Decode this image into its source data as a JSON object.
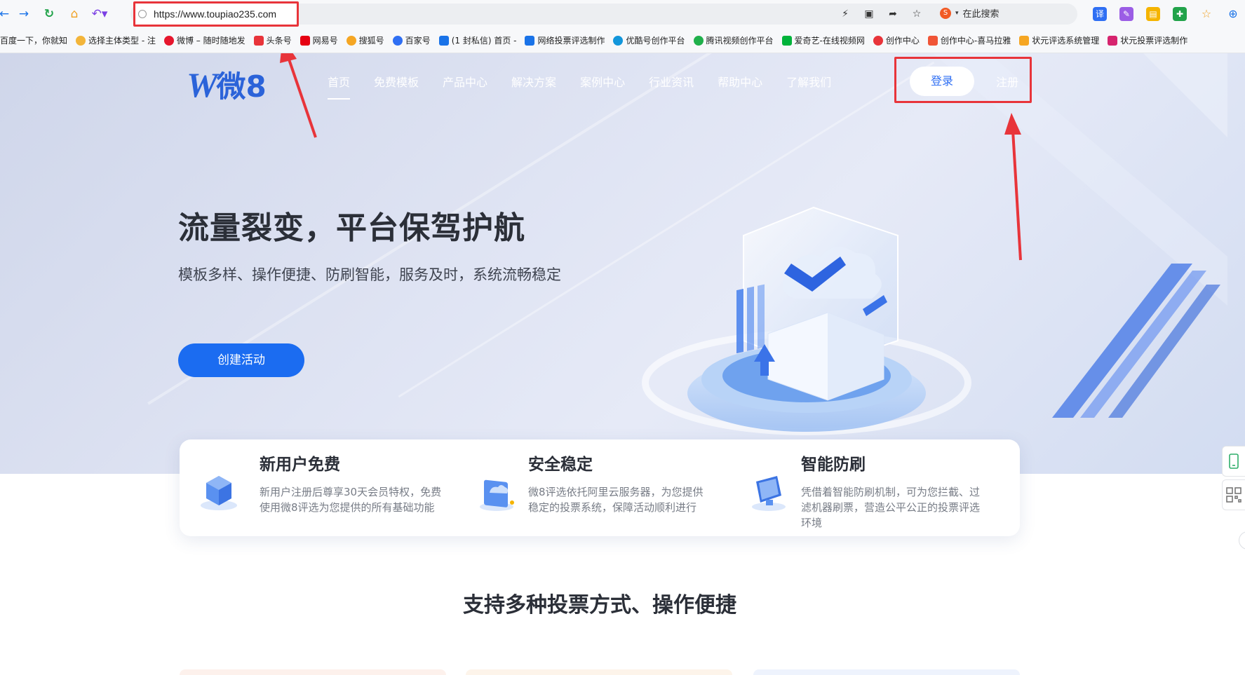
{
  "browser": {
    "url": "https://www.toupiao235.com",
    "search_placeholder": "在此搜索",
    "bookmarks": [
      {
        "label": "百度一下，你就知",
        "color": "#ffffff"
      },
      {
        "label": "选择主体类型 - 注",
        "color": "#f3b53a"
      },
      {
        "label": "微博 – 随时随地发",
        "color": "#e6162d"
      },
      {
        "label": "头条号",
        "color": "#e8343a"
      },
      {
        "label": "网易号",
        "color": "#e60012"
      },
      {
        "label": "搜狐号",
        "color": "#f5a623"
      },
      {
        "label": "百家号",
        "color": "#2f6ff3"
      },
      {
        "label": "(1 封私信) 首页 -",
        "color": "#1a73e8"
      },
      {
        "label": "网络投票评选制作",
        "color": "#1a73e8"
      },
      {
        "label": "优酷号创作平台",
        "color": "#1296db"
      },
      {
        "label": "腾讯视频创作平台",
        "color": "#20b04b"
      },
      {
        "label": "爱奇艺-在线视频网",
        "color": "#00b33a"
      },
      {
        "label": "创作中心",
        "color": "#e8343a"
      },
      {
        "label": "创作中心-喜马拉雅",
        "color": "#f05537"
      },
      {
        "label": "状元评选系统管理",
        "color": "#f5a623"
      },
      {
        "label": "状元投票评选制作",
        "color": "#d6246e"
      }
    ]
  },
  "site": {
    "logo_mark": "W",
    "logo_text": "微8",
    "nav": [
      "首页",
      "免费模板",
      "产品中心",
      "解决方案",
      "案例中心",
      "行业资讯",
      "帮助中心",
      "了解我们"
    ],
    "login_label": "登录",
    "register_label": "注册",
    "hero_title": "流量裂变，平台保驾护航",
    "hero_subtitle": "模板多样、操作便捷、防刷智能，服务及时，系统流畅稳定",
    "cta_label": "创建活动",
    "features": [
      {
        "title": "新用户免费",
        "desc": "新用户注册后尊享30天会员特权，免费使用微8评选为您提供的所有基础功能"
      },
      {
        "title": "安全稳定",
        "desc": "微8评选依托阿里云服务器，为您提供稳定的投票系统，保障活动顺利进行"
      },
      {
        "title": "智能防刷",
        "desc": "凭借着智能防刷机制，可为您拦截、过滤机器刷票，营造公平公正的投票评选环境"
      }
    ],
    "section_title": "支持多种投票方式、操作便捷"
  },
  "colors": {
    "brand_blue": "#1b6cf1",
    "annotation_red": "#e8343a"
  }
}
